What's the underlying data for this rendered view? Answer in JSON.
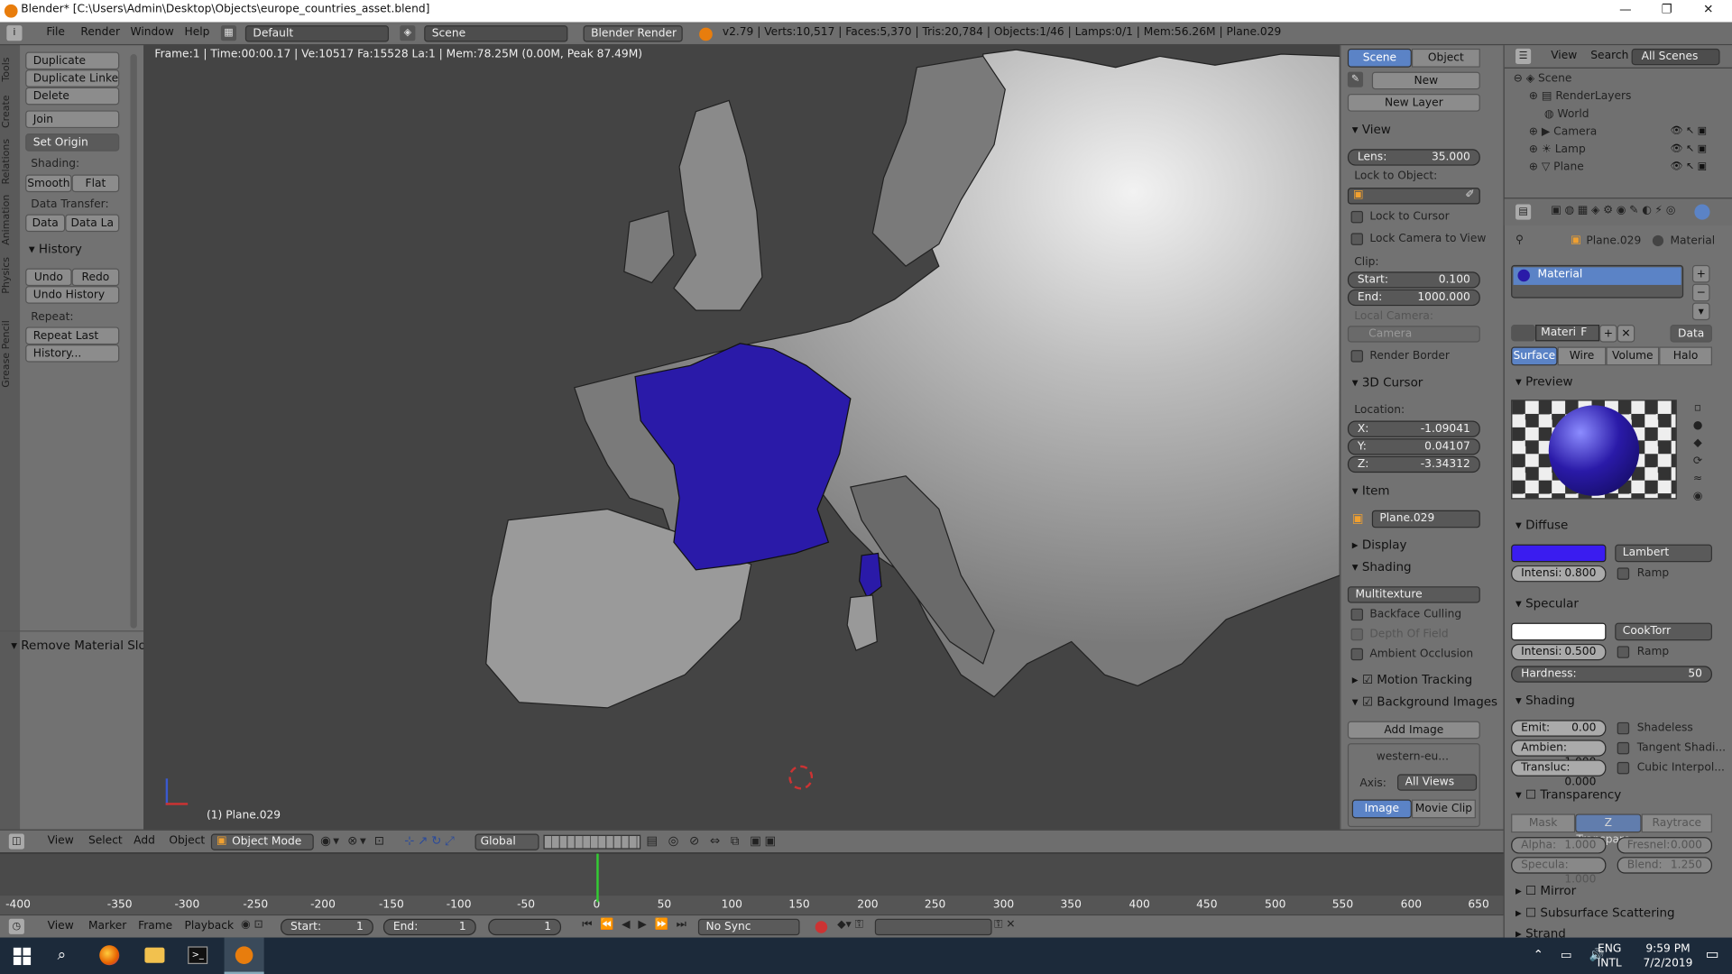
{
  "window": {
    "title": "Blender* [C:\\Users\\Admin\\Desktop\\Objects\\europe_countries_asset.blend]",
    "controls": [
      "—",
      "❐",
      "✕"
    ]
  },
  "topbar": {
    "menus": [
      "File",
      "Render",
      "Window",
      "Help"
    ],
    "layout": "Default",
    "scene": "Scene",
    "engine": "Blender Render",
    "stats": "v2.79 | Verts:10,517 | Faces:5,370 | Tris:20,784 | Objects:1/46 | Lamps:0/1 | Mem:56.26M | Plane.029"
  },
  "toolshelf": {
    "vtabs": [
      "Tools",
      "Create",
      "Relations",
      "Animation",
      "Physics",
      "Grease Pencil"
    ],
    "duplicate": "Duplicate",
    "duplicate_linked": "Duplicate Linked",
    "delete": "Delete",
    "join": "Join",
    "set_origin": "Set Origin",
    "shading_label": "Shading:",
    "smooth": "Smooth",
    "flat": "Flat",
    "data_transfer_label": "Data Transfer:",
    "data": "Data",
    "data_la": "Data La",
    "history": "History",
    "undo": "Undo",
    "redo": "Redo",
    "undo_history": "Undo History",
    "repeat_label": "Repeat:",
    "repeat_last": "Repeat Last",
    "history_dots": "History...",
    "operator": "Remove Material Slot"
  },
  "viewport": {
    "info": "Frame:1 | Time:00:00.17 | Ve:10517 Fa:15528 La:1 | Mem:78.25M (0.00M, Peak 87.49M)",
    "object_label": "(1) Plane.029",
    "highlight_color": "#2a1aa8"
  },
  "view_header": {
    "menus": [
      "View",
      "Select",
      "Add",
      "Object"
    ],
    "mode": "Object Mode",
    "orientation": "Global"
  },
  "timeline": {
    "ticks": [
      "-400",
      "-350",
      "-300",
      "-250",
      "-200",
      "-150",
      "-100",
      "-50",
      "0",
      "50",
      "100",
      "150",
      "200",
      "250",
      "300",
      "350",
      "400",
      "450",
      "500",
      "550",
      "600",
      "650"
    ],
    "menus": [
      "View",
      "Marker",
      "Frame",
      "Playback"
    ],
    "start_label": "Start:",
    "start": "1",
    "end_label": "End:",
    "end": "1",
    "current": "1",
    "sync": "No Sync"
  },
  "npanel": {
    "tabs": [
      "Scene",
      "Object"
    ],
    "new": "New",
    "new_layer": "New Layer",
    "view": "View",
    "lens_label": "Lens:",
    "lens": "35.000",
    "lock_to_object": "Lock to Object:",
    "lock_to_cursor": "Lock to Cursor",
    "lock_camera": "Lock Camera to View",
    "clip": "Clip:",
    "clip_start_label": "Start:",
    "clip_start": "0.100",
    "clip_end_label": "End:",
    "clip_end": "1000.000",
    "local_camera": "Local Camera:",
    "camera": "Camera",
    "render_border": "Render Border",
    "cursor": "3D Cursor",
    "location": "Location:",
    "x_label": "X:",
    "x": "-1.09041",
    "y_label": "Y:",
    "y": "0.04107",
    "z_label": "Z:",
    "z": "-3.34312",
    "item": "Item",
    "item_name": "Plane.029",
    "display": "Display",
    "shading": "Shading",
    "multitexture": "Multitexture",
    "backface": "Backface Culling",
    "dof": "Depth Of Field",
    "ao": "Ambient Occlusion",
    "motion": "Motion Tracking",
    "bg_images": "Background Images",
    "add_image": "Add Image",
    "bg_name": "western-eu...",
    "axis_label": "Axis:",
    "axis": "All Views",
    "image": "Image",
    "movie_clip": "Movie Clip"
  },
  "outliner": {
    "menus": [
      "View",
      "Search"
    ],
    "filter": "All Scenes",
    "items": [
      "Scene",
      "RenderLayers",
      "World",
      "Camera",
      "Lamp",
      "Plane"
    ]
  },
  "properties": {
    "breadcrumb_obj": "Plane.029",
    "breadcrumb_mat": "Material",
    "slot": "Material",
    "mat_name": "Materi",
    "mat_f": "F",
    "data": "Data",
    "tabs": [
      "Surface",
      "Wire",
      "Volume",
      "Halo"
    ],
    "preview": "Preview",
    "diffuse": "Diffuse",
    "diffuse_color": "#3a1cf0",
    "lambert": "Lambert",
    "intensity_label": "Intensi:",
    "diff_int": "0.800",
    "ramp": "Ramp",
    "specular": "Specular",
    "cooktorr": "CookTorr",
    "spec_int": "0.500",
    "hardness_label": "Hardness:",
    "hardness": "50",
    "shading": "Shading",
    "emit_label": "Emit:",
    "emit": "0.00",
    "ambient_label": "Ambien:",
    "ambient": "1.000",
    "transluc_label": "Transluc:",
    "transluc": "0.000",
    "shadeless": "Shadeless",
    "tangent": "Tangent Shadi...",
    "cubic": "Cubic Interpol...",
    "transparency": "Transparency",
    "mask": "Mask",
    "ztrans": "Z Transpare...",
    "raytrace": "Raytrace",
    "alpha_label": "Alpha:",
    "alpha": "1.000",
    "fresnel_label": "Fresnel:",
    "fresnel": "0.000",
    "specula_label": "Specula:",
    "specula": "1.000",
    "blend_label": "Blend:",
    "blend": "1.250",
    "mirror": "Mirror",
    "sss": "Subsurface Scattering",
    "strand": "Strand"
  },
  "taskbar": {
    "lang1": "ENG",
    "lang2": "INTL",
    "time": "9:59 PM",
    "date": "7/2/2019"
  }
}
